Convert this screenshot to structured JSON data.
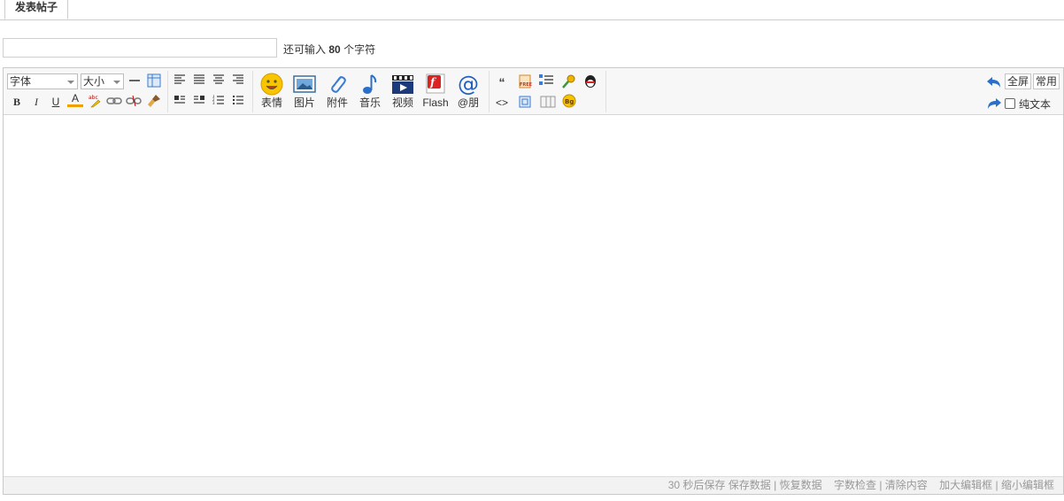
{
  "tabs": [
    {
      "label": "发表帖子"
    }
  ],
  "title_field": {
    "value": "",
    "hint_prefix": "还可输入",
    "hint_count": "80",
    "hint_suffix": "个字符"
  },
  "toolbar": {
    "font_select": "字体",
    "size_select": "大小",
    "format_icons": [
      "bold-icon",
      "italic-icon",
      "underline-icon",
      "font-color-icon",
      "highlight-icon",
      "link-icon",
      "unlink-icon",
      "clean-format-icon"
    ],
    "format_glyphs": {
      "bold": "B",
      "italic": "I",
      "underline": "U",
      "font_color": "A"
    },
    "insert_buttons": [
      {
        "label": "表情",
        "icon": "smiley-icon"
      },
      {
        "label": "图片",
        "icon": "image-icon"
      },
      {
        "label": "附件",
        "icon": "attachment-icon"
      },
      {
        "label": "音乐",
        "icon": "music-icon"
      },
      {
        "label": "视频",
        "icon": "video-icon"
      },
      {
        "label": "Flash",
        "icon": "flash-icon"
      },
      {
        "label": "@朋",
        "icon": "at-icon"
      }
    ],
    "misc_glyphs": {
      "quote": "“",
      "code": "<>",
      "bg": "Bg",
      "free": "FREE"
    },
    "fullscreen_button": "全屏",
    "common_button": "常用",
    "plain_text_label": "纯文本"
  },
  "accent_colors": {
    "smiley": "#f5b400",
    "image": "#3a7bd5",
    "flash": "#d22",
    "video": "#1a3a7a",
    "at": "#1f5fbf"
  },
  "footer": {
    "autosave": "30 秒后保存",
    "save": "保存数据",
    "restore": "恢复数据",
    "check": "字数检查",
    "clear": "清除内容",
    "enlarge": "加大编辑框",
    "shrink": "缩小编辑框"
  }
}
